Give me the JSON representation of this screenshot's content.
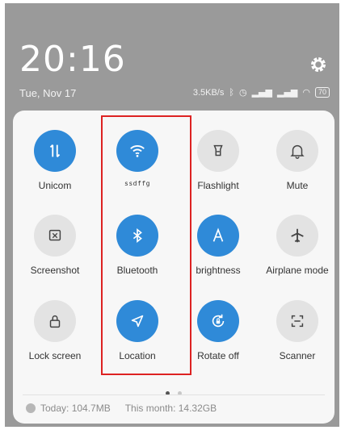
{
  "status_bar": {
    "time": "20:16",
    "date": "Tue, Nov 17",
    "speed": "3.5KB/s",
    "battery": "70",
    "icons": [
      "bluetooth-icon",
      "alarm-icon",
      "signal-icon",
      "signal-icon",
      "wifi-icon",
      "battery-icon"
    ]
  },
  "tiles": [
    {
      "label": "Unicom",
      "state": "on",
      "icon": "mobile-data-icon"
    },
    {
      "label": "ssdffg",
      "state": "on",
      "icon": "wifi-icon"
    },
    {
      "label": "Flashlight",
      "state": "off",
      "icon": "flashlight-icon"
    },
    {
      "label": "Mute",
      "state": "off",
      "icon": "bell-icon"
    },
    {
      "label": "Screenshot",
      "state": "off",
      "icon": "screenshot-icon"
    },
    {
      "label": "Bluetooth",
      "state": "on",
      "icon": "bluetooth-icon"
    },
    {
      "label": "brightness",
      "state": "on",
      "icon": "auto-brightness-icon"
    },
    {
      "label": "Airplane mode",
      "state": "off",
      "icon": "airplane-icon"
    },
    {
      "label": "Lock screen",
      "state": "off",
      "icon": "lock-icon"
    },
    {
      "label": "Location",
      "state": "on",
      "icon": "location-icon"
    },
    {
      "label": "Rotate off",
      "state": "on",
      "icon": "rotate-lock-icon"
    },
    {
      "label": "Scanner",
      "state": "off",
      "icon": "scanner-icon"
    }
  ],
  "pager": {
    "pages": 2,
    "active": 1
  },
  "usage": {
    "today": "Today: 104.7MB",
    "month": "This month: 14.32GB"
  },
  "colors": {
    "accent": "#2f8ad8",
    "off": "#e3e3e3",
    "highlight": "#dd2222"
  }
}
